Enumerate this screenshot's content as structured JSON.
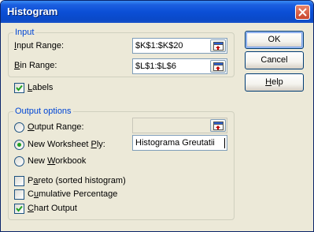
{
  "dialog": {
    "title": "Histogram",
    "close_icon": "close-icon"
  },
  "input_group": {
    "legend": "Input",
    "input_range": {
      "label_pre": "",
      "label_u": "I",
      "label_post": "nput Range:",
      "value": "$K$1:$K$20"
    },
    "bin_range": {
      "label_pre": "",
      "label_u": "B",
      "label_post": "in Range:",
      "value": "$L$1:$L$6"
    }
  },
  "labels_checkbox": {
    "label_pre": "",
    "label_u": "L",
    "label_post": "abels",
    "checked": true
  },
  "output_group": {
    "legend": "Output options",
    "output_range": {
      "label_pre": "",
      "label_u": "O",
      "label_post": "utput Range:",
      "value": "",
      "selected": false
    },
    "new_worksheet": {
      "label_pre": "New Worksheet ",
      "label_u": "P",
      "label_post": "ly:",
      "value": "Histograma Greutatii",
      "selected": true
    },
    "new_workbook": {
      "label_pre": "New ",
      "label_u": "W",
      "label_post": "orkbook",
      "selected": false
    },
    "pareto": {
      "label_pre": "P",
      "label_u": "a",
      "label_post": "reto (sorted histogram)",
      "checked": false
    },
    "cumulative": {
      "label_pre": "C",
      "label_u": "u",
      "label_post": "mulative Percentage",
      "checked": false
    },
    "chart_output": {
      "label_pre": "",
      "label_u": "C",
      "label_post": "hart Output",
      "checked": true
    }
  },
  "buttons": {
    "ok": "OK",
    "cancel": "Cancel",
    "help_pre": "",
    "help_u": "H",
    "help_post": "elp"
  }
}
